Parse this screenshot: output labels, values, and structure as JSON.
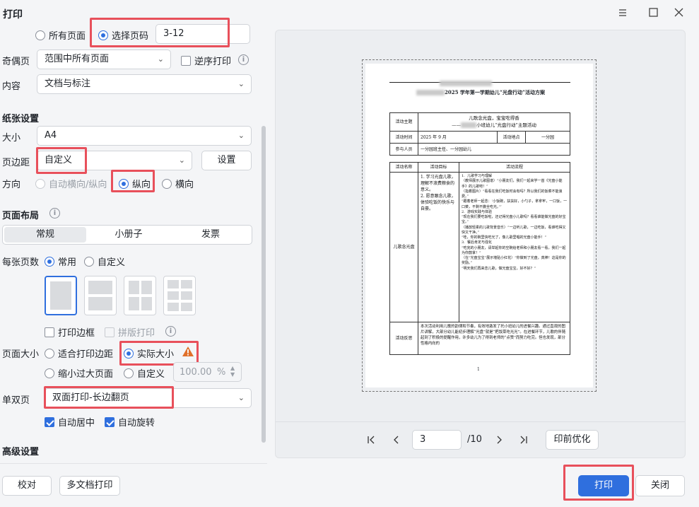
{
  "window": {
    "title": "打印",
    "controls": [
      "menu-icon",
      "maximize-icon",
      "close-icon"
    ]
  },
  "range": {
    "all_pages": "所有页面",
    "selected_pages": "选择页码",
    "page_range_value": "3-12"
  },
  "odd_even": {
    "label": "奇偶页",
    "value": "范围中所有页面",
    "reverse_label": "逆序打印"
  },
  "content": {
    "label": "内容",
    "value": "文档与标注"
  },
  "paper": {
    "section_title": "纸张设置",
    "size_label": "大小",
    "size_value": "A4",
    "margin_label": "页边距",
    "margin_value": "自定义",
    "settings_button": "设置",
    "orientation_label": "方向",
    "orientation_auto": "自动横向/纵向",
    "orientation_portrait": "纵向",
    "orientation_landscape": "横向"
  },
  "layout": {
    "section_title": "页面布局",
    "tabs": [
      "常规",
      "小册子",
      "发票"
    ],
    "per_sheet_label": "每张页数",
    "per_sheet_common": "常用",
    "per_sheet_custom": "自定义",
    "print_border": "打印边框",
    "imposition": "拼版打印",
    "page_size_label": "页面大小",
    "fit_margin": "适合打印边距",
    "actual_size": "实际大小",
    "shrink_oversized": "缩小过大页面",
    "custom_scale": "自定义",
    "scale_value": "100.00",
    "scale_unit": "%"
  },
  "duplex": {
    "label": "单双页",
    "value": "双面打印-长边翻页",
    "auto_center": "自动居中",
    "auto_rotate": "自动旋转"
  },
  "advanced": {
    "section_title": "高级设置"
  },
  "footer": {
    "proof_button": "校对",
    "multi_doc_button": "多文档打印",
    "print_button": "打印",
    "close_button": "关闭"
  },
  "pager": {
    "current_page": "3",
    "total_pages": "/10",
    "optimize_button": "印前优化"
  },
  "document": {
    "title": "2025 学年第一学期幼儿“光盘行动”活动方案",
    "theme_label": "活动主题",
    "theme_line1": "儿歌念光盘，宝宝吃得香",
    "theme_line2": "小班幼儿“光盘行动”主题活动",
    "time_label": "活动时间",
    "time_value": "2025 年 9 月",
    "place_label": "活动地点",
    "place_value": "一分园",
    "people_label": "参与人员",
    "people_value": "一分园班主任、一分园幼儿",
    "col_name": "活动名称",
    "col_goal": "活动目标",
    "col_flow": "活动流程",
    "activity_name": "儿歌念光盘",
    "goal_1_num": "1.",
    "goal_1": "学习光盘儿歌，理解不浪费粮食的意义。",
    "goal_2_num": "2.",
    "goal_2": "愿意跟念儿歌，体验吃饭的快乐与自豪。",
    "flow_lines": [
      "1.  儿歌学习与理解",
      "（教师展示儿歌图谱）“小朋友们，我们一起来学一首《光盘小能手》的儿歌吧！”",
      "（指着图片）“看看在我们吃饭时会有吗？所以我们的饭菜不能浪费。”",
      "“跟着老师一起念：‘小饭碗，扶扶好，小勺子，拿拿牢，一口饭，一口菜，不剩不撒全吃光。’”",
      "2.  游戏实践与体验",
      "“现在我们要吃饭啦，还记得光盘小儿歌吗？看看谁能做光盘的好宝宝。”",
      "（播放轻柔的儿歌背景音乐）“一边听儿歌，一边吃饭，看谁吃得又快又干净。”",
      "“哇，你的碗里快吃光了，像儿歌里唱的光盘小能手！”",
      "3.  餐后肯定与强化",
      "“吃完的小朋友，请举起你的空碗给老师和小朋友看一看，我们一起为你鼓掌！”",
      "（在“光盘宝宝”展示墙贴小红花）“你做到了光盘，真棒！这是你的奖励。”",
      "“明天我们再来念儿歌，做光盘宝宝，好不好？”"
    ],
    "reflection_label": "活动反思",
    "reflection_text": "本次活动利用儿歌的韵律和节奏，有效地激发了托小班幼儿的进餐兴趣。通过直观的图片讲解，大部分幼儿能初步理解“光盘”就是“把饭菜吃光光”。在进餐环节，儿歌的伴随起到了积极的提醒作用，许多幼儿为了得到老师的“点赞”而努力吃完。但也发现，部分性格内向的",
    "page_number": "1"
  }
}
